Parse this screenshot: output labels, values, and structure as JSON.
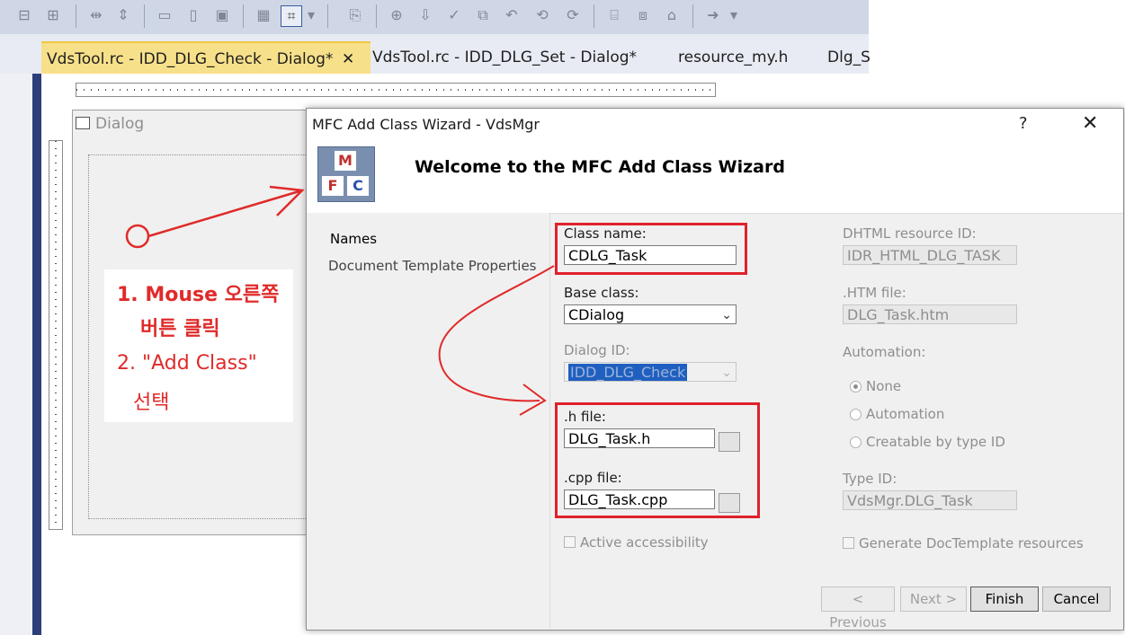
{
  "ide": {
    "tabs": [
      {
        "label": "VdsTool.rc - IDD_DLG_Check - Dialog*",
        "active": true
      },
      {
        "label": "VdsTool.rc - IDD_DLG_Set - Dialog*",
        "active": false
      },
      {
        "label": "resource_my.h",
        "active": false
      },
      {
        "label": "Dlg_S",
        "active": false
      }
    ],
    "tab_close": "✕",
    "left_close": "✕",
    "left_pin": "ı",
    "designer_dialog_title": "Dialog"
  },
  "annotation": {
    "line1": "1. Mouse 오른쪽",
    "line2": "버튼 클릭",
    "line3": "2. \"Add Class\"",
    "line4": "선택",
    "color": "#e02a2a"
  },
  "wizard": {
    "title": "MFC Add Class Wizard - VdsMgr",
    "help": "?",
    "close": "✕",
    "heading": "Welcome to the MFC Add Class Wizard",
    "logo_letters": [
      "M",
      "F",
      "C"
    ],
    "nav": [
      "Names",
      "Document Template Properties"
    ],
    "class_name_label": "Class name:",
    "class_name_value": "CDLG_Task",
    "base_class_label": "Base class:",
    "base_class_value": "CDialog",
    "dialog_id_label": "Dialog ID:",
    "dialog_id_value": "IDD_DLG_Check",
    "h_file_label": ".h file:",
    "h_file_value": "DLG_Task.h",
    "cpp_file_label": ".cpp file:",
    "cpp_file_value": "DLG_Task.cpp",
    "active_accessibility": "Active accessibility",
    "dhtml_label": "DHTML resource ID:",
    "dhtml_value": "IDR_HTML_DLG_TASK",
    "htm_label": ".HTM file:",
    "htm_value": "DLG_Task.htm",
    "automation_label": "Automation:",
    "automation_options": [
      "None",
      "Automation",
      "Creatable by type ID"
    ],
    "automation_selected": "None",
    "type_id_label": "Type ID:",
    "type_id_value": "VdsMgr.DLG_Task",
    "generate_doctemplate": "Generate DocTemplate resources",
    "buttons": {
      "previous": "< Previous",
      "next": "Next >",
      "finish": "Finish",
      "cancel": "Cancel"
    }
  }
}
